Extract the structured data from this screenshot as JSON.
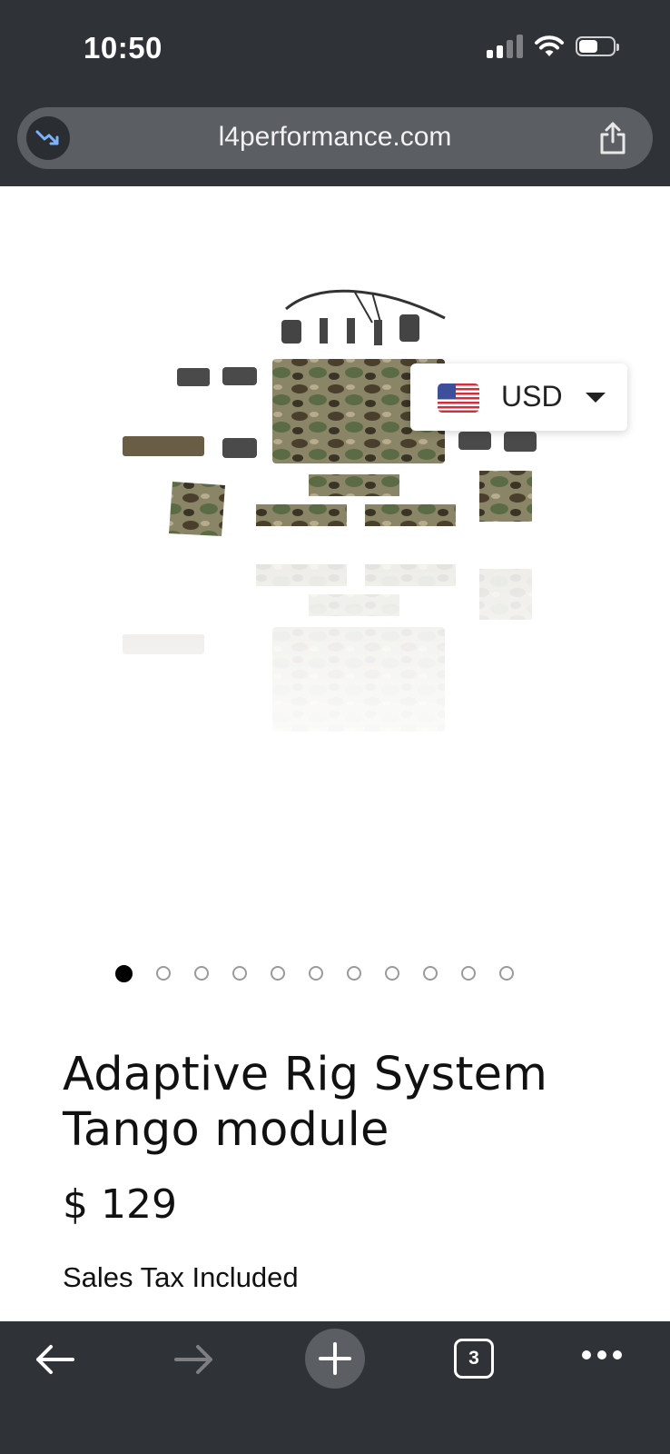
{
  "status_bar": {
    "time": "10:50",
    "icons": [
      "signal-icon",
      "wifi-icon",
      "battery-icon"
    ],
    "battery_level": 0.6
  },
  "browser": {
    "url": "l4performance.com",
    "tab_count": "3",
    "accent_color": "#7cb3ff"
  },
  "currency_selector": {
    "code": "USD",
    "flag": "us-flag-icon"
  },
  "carousel": {
    "slide_count": 11,
    "active_index": 0
  },
  "product": {
    "title": "Adaptive Rig System Tango module",
    "price": "$ 129",
    "tax_note": "Sales Tax Included"
  },
  "toolbar": {
    "items": [
      "back-icon",
      "forward-icon",
      "new-tab-icon",
      "tabs-icon",
      "more-icon"
    ]
  }
}
